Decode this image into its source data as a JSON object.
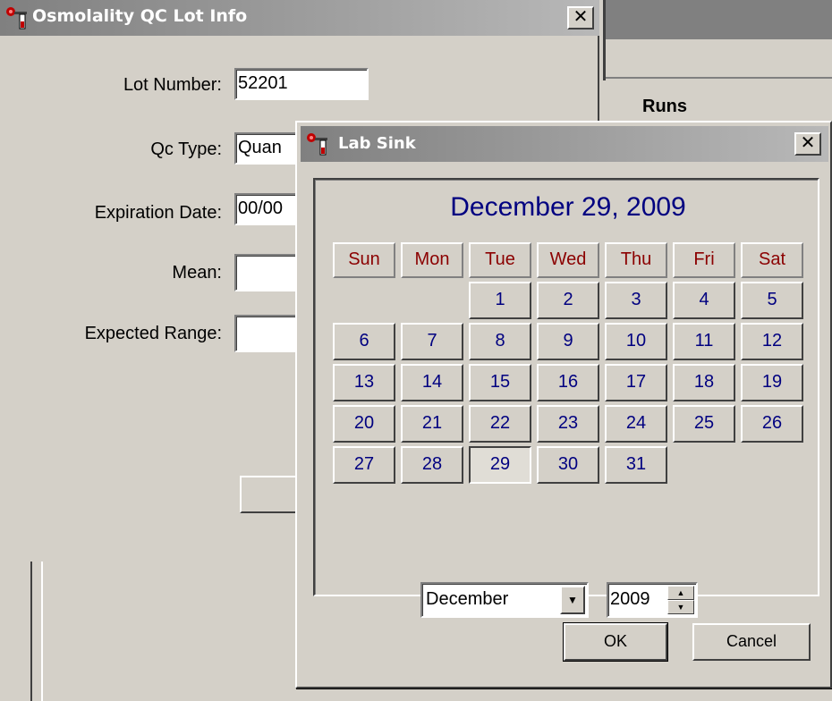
{
  "background_window": {
    "runs_label": "Runs"
  },
  "osmo_window": {
    "title": "Osmolality QC Lot Info",
    "close_label": "✕",
    "fields": {
      "lot_number": {
        "label": "Lot Number:",
        "value": "52201"
      },
      "qc_type": {
        "label": "Qc Type:",
        "value": "Quan"
      },
      "expiration_date": {
        "label": "Expiration Date:",
        "value": "00/00"
      },
      "mean": {
        "label": "Mean:",
        "value": ""
      },
      "expected_range": {
        "label": "Expected Range:",
        "value": ""
      }
    }
  },
  "lab_sink": {
    "title": "Lab Sink",
    "close_label": "✕",
    "calendar": {
      "header": "December 29, 2009",
      "day_names": [
        "Sun",
        "Mon",
        "Tue",
        "Wed",
        "Thu",
        "Fri",
        "Sat"
      ],
      "leading_blanks": 2,
      "days_in_month": 31,
      "selected_day": 29
    },
    "month": "December",
    "year": "2009",
    "ok_label": "OK",
    "cancel_label": "Cancel"
  },
  "colors": {
    "titlebar_inactive": "#808080",
    "window_face": "#d4d0c8",
    "day_name_text": "#8b0000",
    "day_number_text": "#000080",
    "header_text": "#000080"
  }
}
